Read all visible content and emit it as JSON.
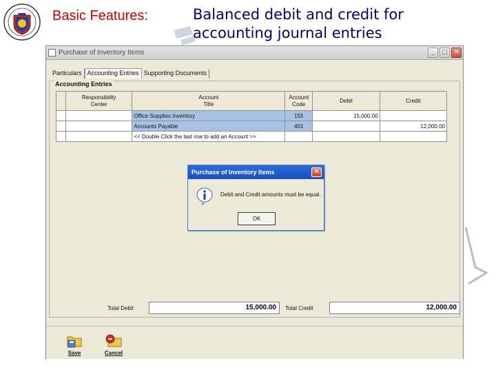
{
  "slide": {
    "label": "Basic Features:",
    "title_line1": "Balanced debit and credit for",
    "title_line2": "accounting journal entries"
  },
  "window": {
    "title": "Purchase of Inventory Items",
    "controls": [
      "minimize",
      "maximize",
      "close"
    ]
  },
  "tabs": [
    {
      "label": "Particulars",
      "active": false
    },
    {
      "label": "Accounting Entries",
      "active": true
    },
    {
      "label": "Supporting Documents",
      "active": false
    }
  ],
  "entries": {
    "group_label": "Accounting Entries",
    "columns": {
      "resp_line1": "Responsibility",
      "resp_line2": "Center",
      "acct_line1": "Account",
      "acct_line2": "Title",
      "code_line1": "Account",
      "code_line2": "Code",
      "debit": "Debit",
      "credit": "Credit"
    },
    "rows": [
      {
        "responsibility_center": "",
        "account_title": "Office Supplies Inventory",
        "account_code": "155",
        "debit": "15,000.00",
        "credit": ""
      },
      {
        "responsibility_center": "",
        "account_title": "Accounts Payable",
        "account_code": "401",
        "debit": "",
        "credit": "12,000.00"
      },
      {
        "responsibility_center": "",
        "account_title": "<< Double Click the last row to add an Account >>",
        "account_code": "",
        "debit": "",
        "credit": ""
      }
    ]
  },
  "totals": {
    "debit_label": "Total Debit",
    "debit_value": "15,000.00",
    "credit_label": "Total Credit",
    "credit_value": "12,000.00"
  },
  "toolbar": {
    "save_label": "Save",
    "cancel_label": "Cancel"
  },
  "dialog": {
    "title": "Purchase of Inventory Items",
    "message": "Debit and Credit amounts must be equal.",
    "ok_label": "OK",
    "icon": "info-icon"
  },
  "colors": {
    "slide_label": "#c00000",
    "slide_title": "#000066",
    "row_highlight": "#a7c2e4",
    "dialog_titlebar": "#2a6ce0"
  }
}
